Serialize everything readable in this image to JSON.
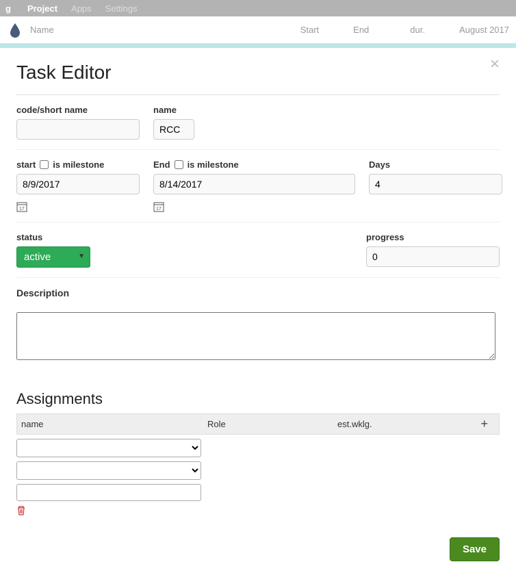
{
  "topbar": {
    "g": "g",
    "project": "Project",
    "apps": "Apps",
    "settings": "Settings"
  },
  "columns": {
    "name": "Name",
    "start": "Start",
    "end": "End",
    "dur": "dur.",
    "month": "August 2017"
  },
  "modal": {
    "title": "Task Editor",
    "assignments_title": "Assignments",
    "labels": {
      "code": "code/short name",
      "name": "name",
      "start": "start",
      "is_milestone": "is milestone",
      "end": "End",
      "days": "Days",
      "status": "status",
      "progress": "progress",
      "description": "Description"
    },
    "values": {
      "code": "",
      "name": "RCC",
      "start": "8/9/2017",
      "start_milestone": false,
      "end": "8/14/2017",
      "end_milestone": false,
      "days": "4",
      "status": "active",
      "progress": "0",
      "description": ""
    },
    "assign_cols": {
      "name": "name",
      "role": "Role",
      "est": "est.wklg.",
      "add": "+"
    },
    "save": "Save"
  }
}
